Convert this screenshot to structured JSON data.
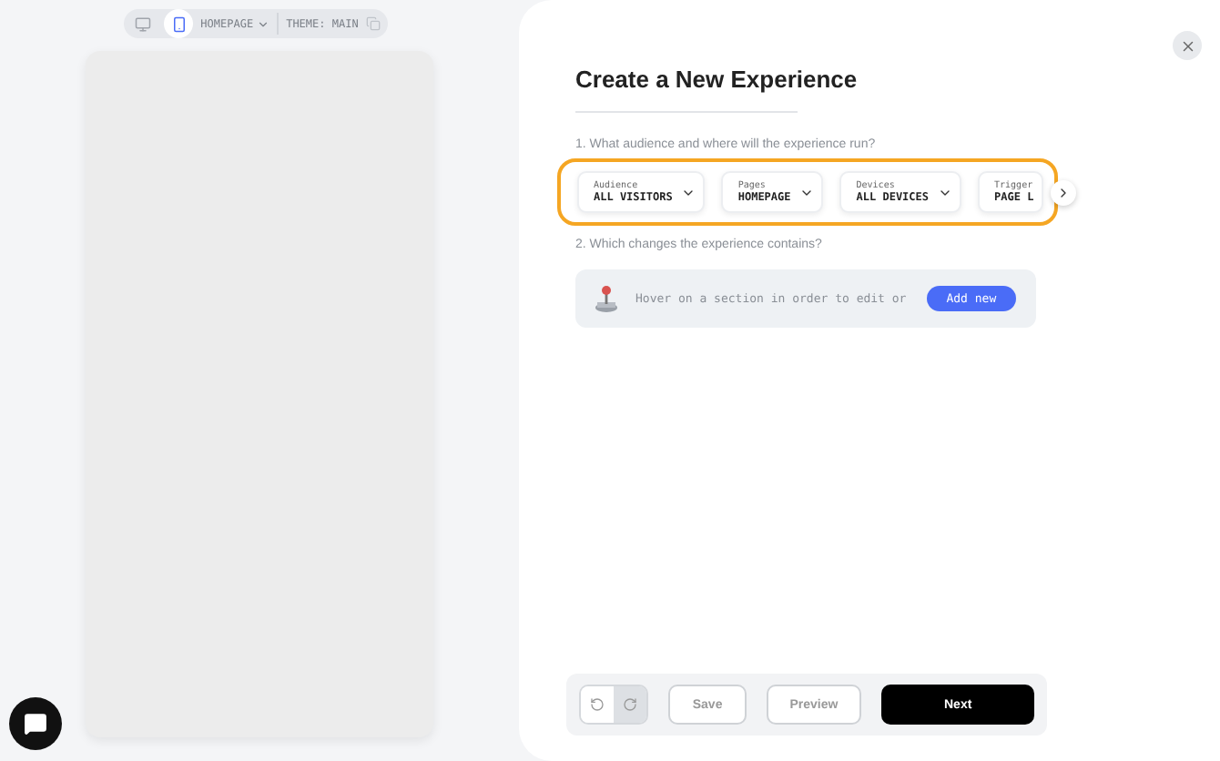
{
  "preview_toolbar": {
    "devices": [
      {
        "kind": "desktop",
        "selected": false
      },
      {
        "kind": "mobile",
        "selected": true
      }
    ],
    "page": "HOMEPAGE",
    "theme": "THEME: MAIN"
  },
  "title": "Create a New Experience",
  "question_1": "1. What audience and where will the experience run?",
  "selectors": [
    {
      "label": "Audience",
      "value": "ALL VISITORS"
    },
    {
      "label": "Pages",
      "value": "HOMEPAGE"
    },
    {
      "label": "Devices",
      "value": "ALL DEVICES"
    },
    {
      "label": "Trigger",
      "value": "PAGE L"
    }
  ],
  "question_2": "2. Which changes the experience contains?",
  "changes_hint": "Hover on a section in order to edit or",
  "add_button": "Add new",
  "history": [
    {
      "kind": "undo",
      "disabled": false
    },
    {
      "kind": "redo",
      "disabled": true
    }
  ],
  "actions": [
    {
      "kind": "secondary",
      "label": "Save"
    },
    {
      "kind": "secondary",
      "label": "Preview"
    },
    {
      "kind": "primary",
      "label": "Next"
    }
  ]
}
